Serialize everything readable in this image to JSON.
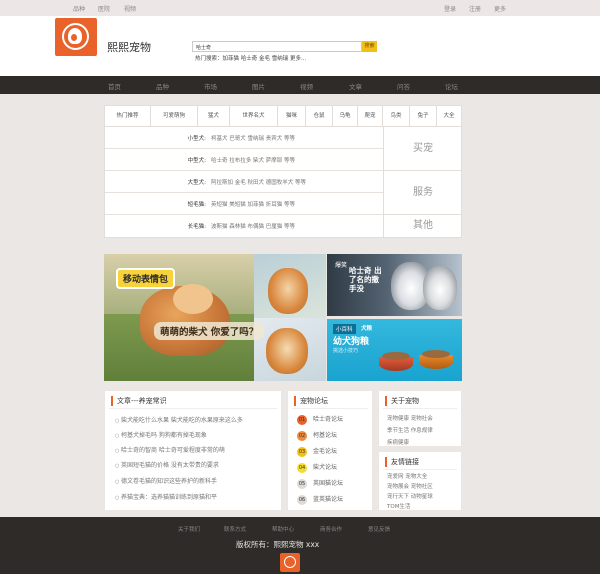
{
  "topbar": {
    "left": [
      "品种",
      "医院",
      "视频"
    ],
    "right": [
      "登录",
      "注册",
      "更多"
    ]
  },
  "brand": {
    "name": "熙熙宠物"
  },
  "search": {
    "value": "哈士奇",
    "button": "搜索",
    "hot": "热门搜索：加菲猫 哈士奇 金毛 雪纳瑞 更多..."
  },
  "nav": [
    "首页",
    "品种",
    "市场",
    "图片",
    "视频",
    "文章",
    "问答",
    "论坛"
  ],
  "category": {
    "tabs": [
      "热门推荐",
      "可爱萌狗",
      "猛犬",
      "世界名犬",
      "猫咪",
      "仓鼠",
      "乌龟",
      "爬宠",
      "鸟类",
      "兔子",
      "大全"
    ],
    "rows": [
      {
        "label": "小型犬:",
        "items": "柯基犬 巴哥犬 雪纳瑞 贵宾犬 等等"
      },
      {
        "label": "中型犬:",
        "items": "哈士奇 拉布拉多 柴犬 萨摩耶 等等"
      },
      {
        "label": "大型犬:",
        "items": "阿拉斯加 金毛 秋田犬 德国牧羊犬 等等"
      },
      {
        "label": "短毛猫:",
        "items": "英短猫 美短猫 加菲猫 折耳猫 等等"
      },
      {
        "label": "长毛猫:",
        "items": "波斯猫 森林猫 布偶猫 巴厘猫 等等"
      }
    ],
    "side": [
      "买宠",
      "服务",
      "其他"
    ]
  },
  "banner": {
    "tag": "移动表情包",
    "caption": "萌萌的柴犬 你爱了吗？",
    "top_small": "爆笑",
    "top_big": "哈士奇 出了名的撒手没",
    "bottom_badge": "小百科",
    "bottom_head": "犬粮",
    "bottom_title": "幼犬狗粮",
    "bottom_sub": "挑选小技巧"
  },
  "articles": {
    "title": "文章---养宠常识",
    "items": [
      "柴犬能吃什么水果 柴犬能吃的水果原来这么多",
      "柯基犬掉毛吗 狗狗都有掉毛现象",
      "哈士奇的智商 哈士奇可爱程度非常的萌",
      "英国短毛猫的价格 没有太带贵的要求",
      "德文卷毛猫的知识这些养护的新科手",
      "养猫宝典：选养猫猫训练到原猫和平"
    ]
  },
  "forum": {
    "title": "宠物论坛",
    "items": [
      {
        "num": "01",
        "label": "哈士奇论坛",
        "color": "#e8622a"
      },
      {
        "num": "02",
        "label": "柯基论坛",
        "color": "#ef8a3a"
      },
      {
        "num": "03",
        "label": "金毛论坛",
        "color": "#f2bf1a"
      },
      {
        "num": "04",
        "label": "柴犬论坛",
        "color": "#f6dc2b"
      },
      {
        "num": "05",
        "label": "英国猫论坛",
        "color": "#dedad6"
      },
      {
        "num": "06",
        "label": "蓝英猫论坛",
        "color": "#dedad6"
      }
    ]
  },
  "about": {
    "title": "关于宠物",
    "rows": [
      "宠物健康  宠物社会",
      "季节生活  作息规律",
      "疾病健康"
    ]
  },
  "friends": {
    "title": "友情链接",
    "rows": [
      "宠爱网  宠物大全",
      "宠物展会  宠物社区",
      "宠行天下  动物星球",
      "TOM生活"
    ]
  },
  "footer": {
    "links": [
      "关于我们",
      "联系方式",
      "帮助中心",
      "商务合作",
      "意见反馈"
    ],
    "copyright": "版权所有：熙熙宠物 xxx"
  }
}
